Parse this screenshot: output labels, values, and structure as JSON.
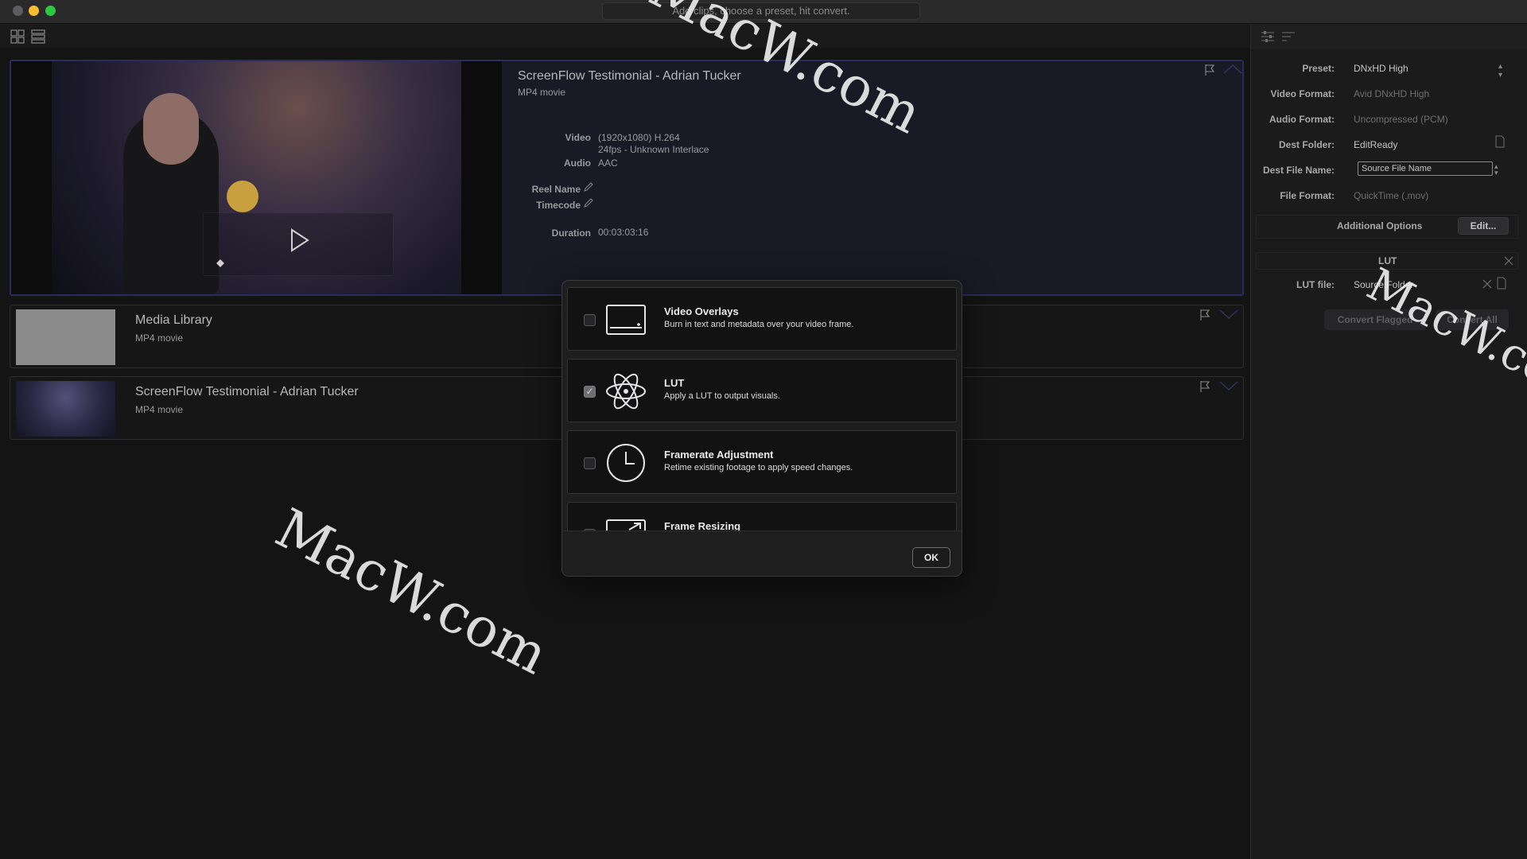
{
  "window": {
    "hint": "Add clips, choose a preset, hit convert."
  },
  "clips": [
    {
      "title": "ScreenFlow Testimonial - Adrian Tucker",
      "type": "MP4 movie",
      "meta": {
        "video_label": "Video",
        "video_value_1": "(1920x1080) H.264",
        "video_value_2": "24fps - Unknown Interlace",
        "audio_label": "Audio",
        "audio_value": "AAC",
        "reel_label": "Reel Name",
        "timecode_label": "Timecode",
        "duration_label": "Duration",
        "duration_value": "00:03:03:16"
      },
      "selected": true
    },
    {
      "title": "Media Library",
      "type": "MP4 movie"
    },
    {
      "title": "ScreenFlow Testimonial - Adrian Tucker",
      "type": "MP4 movie"
    }
  ],
  "settings": {
    "preset_label": "Preset:",
    "preset_value": "DNxHD High",
    "video_format_label": "Video Format:",
    "video_format_value": "Avid DNxHD High",
    "audio_format_label": "Audio Format:",
    "audio_format_value": "Uncompressed (PCM)",
    "dest_folder_label": "Dest Folder:",
    "dest_folder_value": "EditReady",
    "dest_file_label": "Dest File Name:",
    "dest_file_value": "Source File Name",
    "file_format_label": "File Format:",
    "file_format_value": "QuickTime (.mov)",
    "additional_label": "Additional Options",
    "edit_label": "Edit...",
    "lut_section_label": "LUT",
    "lut_file_label": "LUT file:",
    "lut_file_value": "Source Folder",
    "convert_flagged_label": "Convert Flagged",
    "convert_all_label": "Convert All"
  },
  "modal": {
    "options": [
      {
        "title": "Video Overlays",
        "desc": "Burn in text and metadata over your video frame.",
        "checked": false,
        "icon": "overlay-icon"
      },
      {
        "title": "LUT",
        "desc": "Apply a LUT to output visuals.",
        "checked": true,
        "check_glyph": "✓",
        "icon": "atom-icon"
      },
      {
        "title": "Framerate Adjustment",
        "desc": "Retime existing footage to apply speed changes.",
        "checked": false,
        "icon": "clock-icon"
      },
      {
        "title": "Frame Resizing",
        "desc": "",
        "checked": false,
        "icon": "resize-icon"
      }
    ],
    "ok_label": "OK"
  },
  "watermark": "MacW.com",
  "colors": {
    "accent_selected_border": "#2c2c5c",
    "traffic_close": "#5e5e60",
    "traffic_min": "#f6be2f",
    "traffic_max": "#2bc840"
  }
}
